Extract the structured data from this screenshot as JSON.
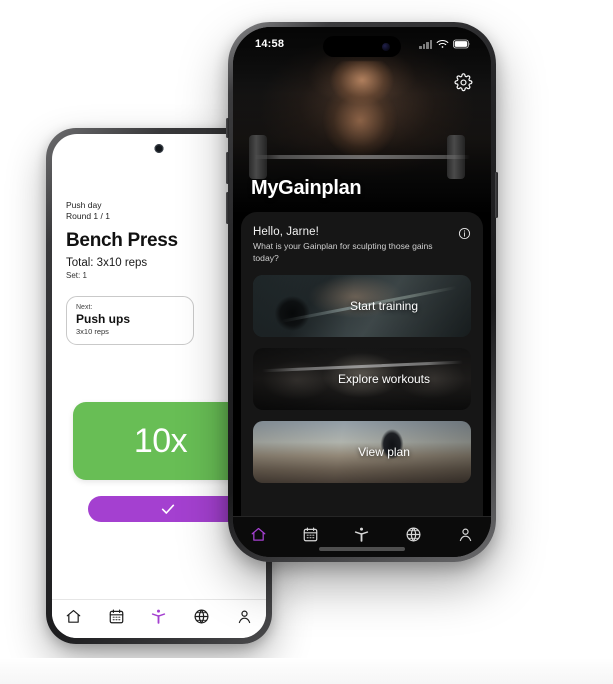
{
  "scene": {
    "description": "Two mockup phones showing the MyGainplan fitness app",
    "accent_purple": "#a440d0",
    "accent_green": "#68be55",
    "background": "#ffffff"
  },
  "iphone": {
    "status_bar": {
      "time": "14:58",
      "cellular_icon": "cellular-signal-icon",
      "wifi_icon": "wifi-icon",
      "battery_icon": "battery-icon"
    },
    "hero": {
      "app_title": "MyGainplan",
      "settings_icon": "gear-icon"
    },
    "sheet": {
      "greeting_title": "Hello, Jarne!",
      "greeting_subtitle": "What is your Gainplan for sculpting those gains today?",
      "info_icon": "info-circle-icon",
      "cards": [
        {
          "label": "Start training",
          "name": "start-training-card"
        },
        {
          "label": "Explore workouts",
          "name": "explore-workouts-card"
        },
        {
          "label": "View plan",
          "name": "view-plan-card"
        }
      ]
    },
    "tabbar": {
      "active_index": 0,
      "items": [
        {
          "label": "Home",
          "icon": "home-icon"
        },
        {
          "label": "Calendar",
          "icon": "calendar-icon"
        },
        {
          "label": "Workout",
          "icon": "person-raised-arms-icon"
        },
        {
          "label": "Explore",
          "icon": "globe-icon"
        },
        {
          "label": "Profile",
          "icon": "person-icon"
        }
      ]
    }
  },
  "android": {
    "workout": {
      "day": "Push day",
      "round": "Round 1 / 1",
      "exercise": "Bench Press",
      "total": "Total: 3x10 reps",
      "set": "Set: 1"
    },
    "next_card": {
      "kicker": "Next:",
      "exercise": "Push ups",
      "reps": "3x10 reps"
    },
    "rep_button": {
      "label": "10x",
      "color": "#68be55"
    },
    "confirm_button": {
      "icon": "check-icon",
      "color": "#a440d0"
    },
    "tabbar": {
      "active_index": 2,
      "items": [
        {
          "label": "Home",
          "icon": "home-icon"
        },
        {
          "label": "Calendar",
          "icon": "calendar-icon"
        },
        {
          "label": "Workout",
          "icon": "person-raised-arms-icon"
        },
        {
          "label": "Explore",
          "icon": "globe-icon"
        },
        {
          "label": "Profile",
          "icon": "person-icon"
        }
      ]
    }
  }
}
